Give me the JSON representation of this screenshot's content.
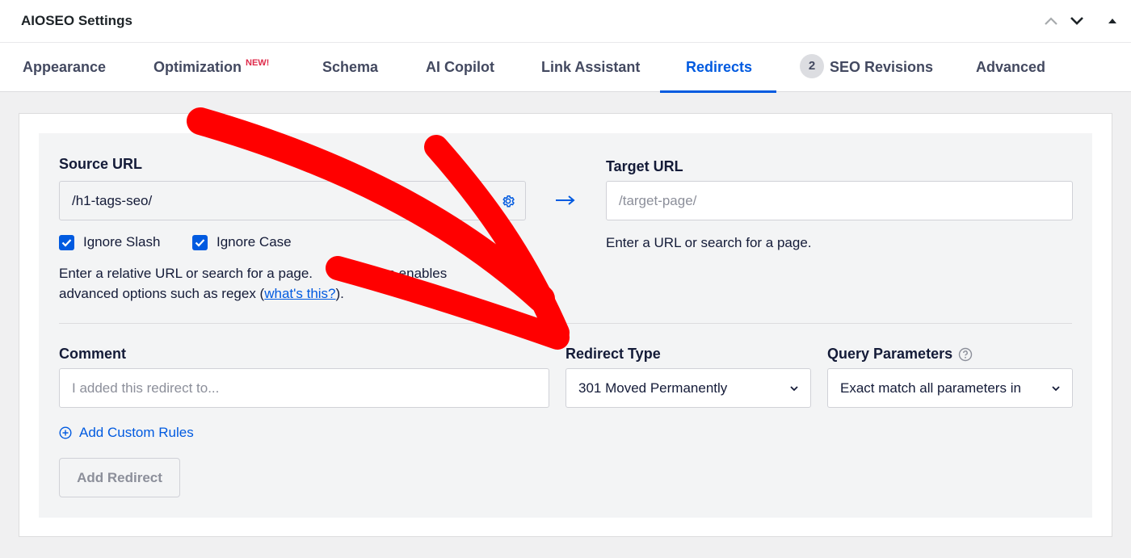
{
  "header": {
    "title": "AIOSEO Settings"
  },
  "tabs": {
    "appearance": "Appearance",
    "optimization": "Optimization",
    "optimization_badge": "NEW!",
    "schema": "Schema",
    "ai_copilot": "AI Copilot",
    "link_assistant": "Link Assistant",
    "redirects": "Redirects",
    "seo_revisions_count": "2",
    "seo_revisions": "SEO Revisions",
    "advanced": "Advanced",
    "active": "Redirects"
  },
  "redirect_form": {
    "source_label": "Source URL",
    "source_value": "/h1-tags-seo/",
    "target_label": "Target URL",
    "target_placeholder": "/target-page/",
    "ignore_slash": "Ignore Slash",
    "ignore_slash_checked": true,
    "ignore_case": "Ignore Case",
    "ignore_case_checked": true,
    "source_help_line1": "Enter a relative URL or search for a page.",
    "source_help_line1_cont": "icon enables",
    "source_help_line2_pre": "advanced options such as regex (",
    "source_help_link": "what's this?",
    "source_help_line2_post": ").",
    "target_help": "Enter a URL or search for a page.",
    "comment_label": "Comment",
    "comment_placeholder": "I added this redirect to...",
    "redirect_type_label": "Redirect Type",
    "redirect_type_value": "301 Moved Permanently",
    "query_params_label": "Query Parameters",
    "query_params_value": "Exact match all parameters in",
    "add_custom_rules": "Add Custom Rules",
    "add_redirect_button": "Add Redirect"
  },
  "colors": {
    "accent": "#005ae0",
    "annotation_arrow": "#ff0000",
    "new_badge": "#df2a4a"
  },
  "icons": [
    "chevron-up-icon",
    "chevron-down-icon",
    "triangle-up-icon",
    "gear-icon",
    "arrow-right-icon",
    "checkbox-checked-icon",
    "question-circle-icon",
    "plus-circle-icon"
  ]
}
